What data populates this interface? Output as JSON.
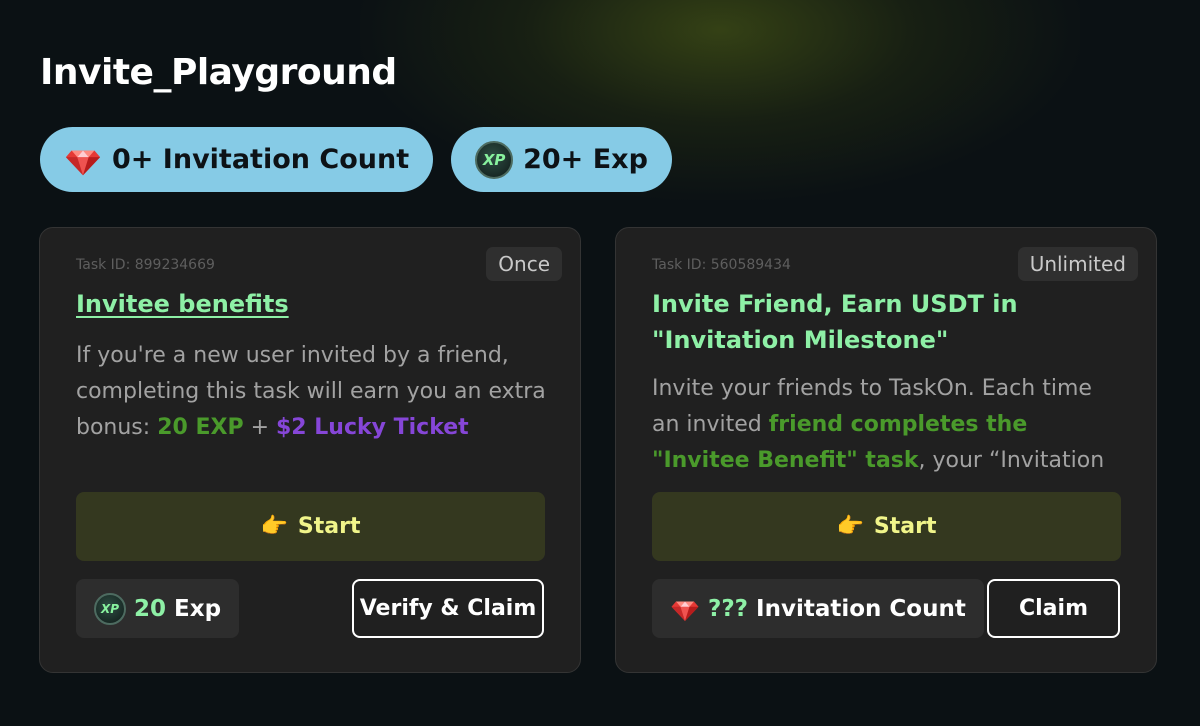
{
  "page": {
    "title": "Invite_Playground"
  },
  "chips": [
    {
      "icon": "gem-icon",
      "label": "0+ Invitation Count"
    },
    {
      "icon": "xp-icon",
      "badge_text": "XP",
      "label": "20+ Exp"
    }
  ],
  "tasks": [
    {
      "task_id": "Task ID: 899234669",
      "frequency": "Once",
      "title": "Invitee benefits",
      "description": {
        "part1": "If you're a new user invited by a friend, completing this task will earn you an extra bonus: ",
        "hl1": "20 EXP",
        "part2": " + ",
        "hl2": "$2 Lucky Ticket"
      },
      "start_icon": "👉",
      "start_label": "Start",
      "reward": {
        "icon": "xp-icon",
        "badge_text": "XP",
        "amount": "20",
        "unit": "Exp"
      },
      "claim_label": "Verify & Claim"
    },
    {
      "task_id": "Task ID: 560589434",
      "frequency": "Unlimited",
      "title": "Invite Friend, Earn USDT in \"Invitation Milestone\"",
      "description": {
        "part1": "Invite your friends to TaskOn. Each time an invited ",
        "hl1": "friend completes the \"Invitee Benefit\" task",
        "part2": ", your “Invitation Count” will"
      },
      "start_icon": "👉",
      "start_label": "Start",
      "reward": {
        "icon": "gem-icon",
        "amount": "???",
        "unit": "Invitation Count"
      },
      "claim_label": "Claim"
    }
  ],
  "colors": {
    "background": "#0b1114",
    "chip": "#86cbe6",
    "accent_green": "#8ef0a6",
    "start_bg": "#34381f",
    "start_text": "#f1f58a",
    "highlight_purple": "#8646d8"
  }
}
